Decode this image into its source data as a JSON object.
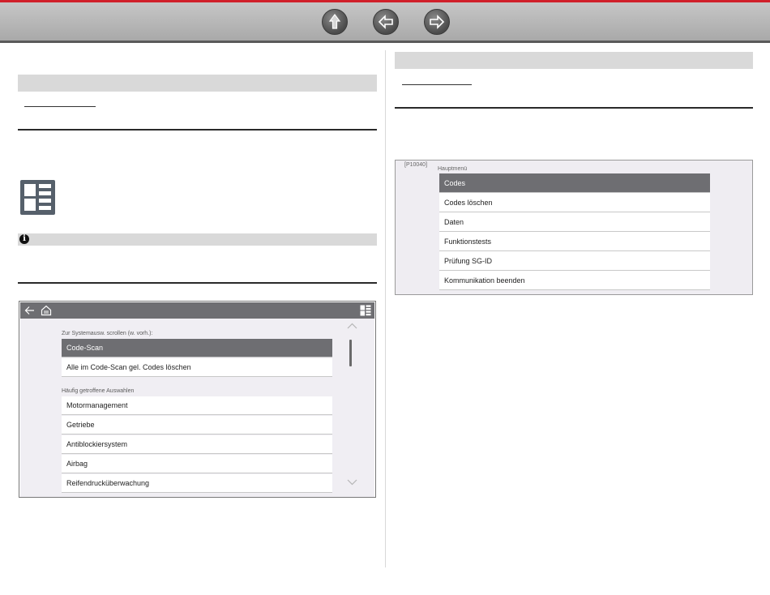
{
  "nav": {
    "up_icon": "up-arrow-icon",
    "back_icon": "left-arrow-icon",
    "forward_icon": "right-arrow-icon",
    "accent_color": "#d0202a"
  },
  "left_screenshot": {
    "caption_scroll": "Zur Systemausw. scrollen (w. vorh.):",
    "top_items": [
      {
        "label": "Code-Scan",
        "selected": true
      },
      {
        "label": "Alle im Code-Scan gel. Codes löschen",
        "selected": false
      }
    ],
    "caption_frequent": "Häufig getroffene Auswahlen",
    "frequent_items": [
      {
        "label": "Motormanagement"
      },
      {
        "label": "Getriebe"
      },
      {
        "label": "Antiblockiersystem"
      },
      {
        "label": "Airbag"
      },
      {
        "label": "Reifendrucküberwachung"
      }
    ]
  },
  "right_screenshot": {
    "figure_id": "[P10040]",
    "caption": "Hauptmenü",
    "items": [
      {
        "label": "Codes",
        "selected": true
      },
      {
        "label": "Codes löschen",
        "selected": false
      },
      {
        "label": "Daten",
        "selected": false
      },
      {
        "label": "Funktionstests",
        "selected": false
      },
      {
        "label": "Prüfung SG-ID",
        "selected": false
      },
      {
        "label": "Kommunikation beenden",
        "selected": false
      }
    ]
  }
}
